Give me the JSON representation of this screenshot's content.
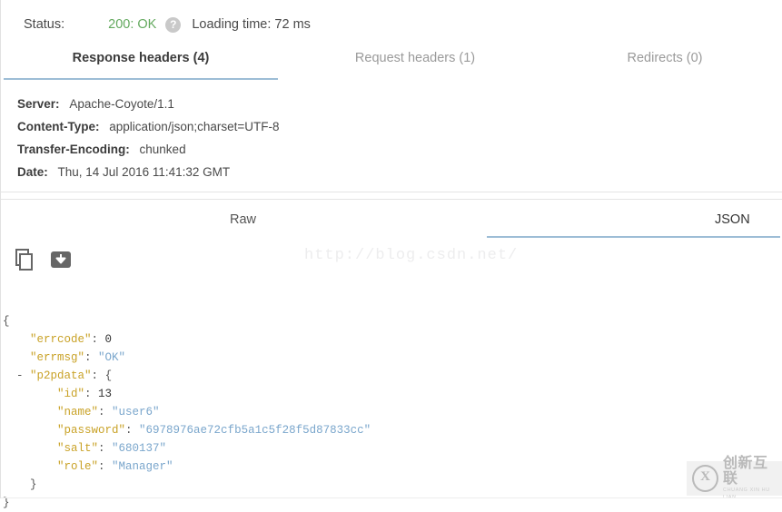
{
  "status": {
    "label": "Status:",
    "code": "200: OK",
    "code_color": "#63a95e",
    "help_icon": "question-mark-icon",
    "help_glyph": "?",
    "loading_time": "Loading time: 72 ms"
  },
  "header_tabs": [
    {
      "label": "Response headers (4)",
      "active": true
    },
    {
      "label": "Request headers (1)",
      "active": false
    },
    {
      "label": "Redirects (0)",
      "active": false
    }
  ],
  "response_headers": [
    {
      "key": "Server:",
      "value": "Apache-Coyote/1.1"
    },
    {
      "key": "Content-Type:",
      "value": "application/json;charset=UTF-8"
    },
    {
      "key": "Transfer-Encoding:",
      "value": "chunked"
    },
    {
      "key": "Date:",
      "value": "Thu, 14 Jul 2016 11:41:32 GMT"
    }
  ],
  "body_tabs": [
    {
      "label": "Raw",
      "active": false
    },
    {
      "label": "JSON",
      "active": true
    }
  ],
  "actions": [
    {
      "icon": "copy-icon",
      "name": "copy-to-clipboard-button"
    },
    {
      "icon": "save-download-icon",
      "name": "save-response-button"
    }
  ],
  "accent_color": "#9dbdd6",
  "json_body": {
    "lines": [
      {
        "indent": 0,
        "toggle": "",
        "key": "",
        "sep": "",
        "value": "{",
        "type": "punct"
      },
      {
        "indent": 1,
        "toggle": "",
        "key": "errcode",
        "sep": ": ",
        "value": "0",
        "type": "number"
      },
      {
        "indent": 1,
        "toggle": "",
        "key": "errmsg",
        "sep": ": ",
        "value": "OK",
        "type": "string"
      },
      {
        "indent": 1,
        "toggle": "-",
        "key": "p2pdata",
        "sep": ": ",
        "value": "{",
        "type": "punct"
      },
      {
        "indent": 2,
        "toggle": "",
        "key": "id",
        "sep": ": ",
        "value": "13",
        "type": "number"
      },
      {
        "indent": 2,
        "toggle": "",
        "key": "name",
        "sep": ": ",
        "value": "user6",
        "type": "string"
      },
      {
        "indent": 2,
        "toggle": "",
        "key": "password",
        "sep": ": ",
        "value": "6978976ae72cfb5a1c5f28f5d87833cc",
        "type": "string"
      },
      {
        "indent": 2,
        "toggle": "",
        "key": "salt",
        "sep": ": ",
        "value": "680137",
        "type": "string"
      },
      {
        "indent": 2,
        "toggle": "",
        "key": "role",
        "sep": ": ",
        "value": "Manager",
        "type": "string"
      },
      {
        "indent": 1,
        "toggle": "",
        "key": "",
        "sep": "",
        "value": "}",
        "type": "punct"
      },
      {
        "indent": 0,
        "toggle": "",
        "key": "",
        "sep": "",
        "value": "}",
        "type": "punct"
      }
    ],
    "key_color": "#c9a227",
    "string_color": "#7aa6cc",
    "number_color": "#333333"
  },
  "watermarks": {
    "url": "http://blog.csdn.net/",
    "logo_mark": "X",
    "logo_cn": "创新互联",
    "logo_pinyin": "CHUANG XIN HU LIAN"
  }
}
